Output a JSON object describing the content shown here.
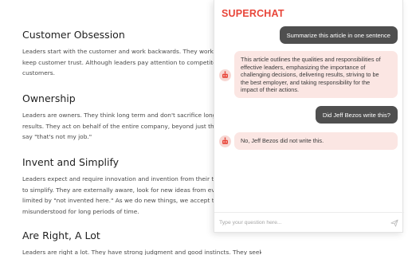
{
  "article": {
    "sections": [
      {
        "title": "Customer Obsession",
        "lines": [
          "Leaders start with the customer and work backwards. They work vigo",
          "keep customer trust. Although leaders pay attention to competitors, t",
          "customers."
        ]
      },
      {
        "title": "Ownership",
        "lines": [
          "Leaders are owners. They think long term and don't sacrifice long-ter",
          "results. They act on behalf of the entire company, beyond just their ov",
          "say \"that's not my job.\""
        ]
      },
      {
        "title": "Invent and Simplify",
        "lines": [
          "Leaders expect and require innovation and invention from their teams",
          "to simplify. They are externally aware, look for new ideas from everyv",
          "limited by \"not invented here.\" As we do new things, we accept that w",
          "misunderstood for long periods of time."
        ]
      },
      {
        "title": "Are Right, A Lot",
        "lines": [
          "Leaders are right a lot. They have strong judgment and good instincts. They seek diverse"
        ]
      }
    ]
  },
  "chat": {
    "title": "SUPERCHAT",
    "accent_color": "#e8463a",
    "messages": [
      {
        "role": "user",
        "text": "Summarize this article in one sentence"
      },
      {
        "role": "bot",
        "lines": [
          "This article outlines the qualities and responsibilities of",
          "effective leaders, emphasizing the importance of",
          "challenging decisions, delivering results, striving to be",
          "the best employer, and taking responsibility for the",
          "impact of their actions."
        ]
      },
      {
        "role": "user",
        "text": "Did Jeff Bezos write this?"
      },
      {
        "role": "bot",
        "lines": [
          "No, Jeff Bezos did not write this."
        ]
      }
    ],
    "input": {
      "placeholder": "Type your question here...",
      "value": ""
    },
    "icons": {
      "bot_avatar": "robot-icon",
      "send": "send-icon"
    }
  }
}
